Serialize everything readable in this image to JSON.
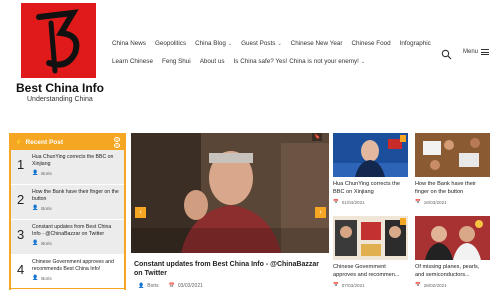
{
  "site": {
    "title": "Best China Info",
    "tagline": "Understanding China"
  },
  "nav": {
    "row1": [
      {
        "label": "China News",
        "has_dropdown": false
      },
      {
        "label": "Geopolitics",
        "has_dropdown": false
      },
      {
        "label": "China Blog",
        "has_dropdown": true
      },
      {
        "label": "Guest Posts",
        "has_dropdown": true
      },
      {
        "label": "Chinese New Year",
        "has_dropdown": false
      },
      {
        "label": "Chinese Food",
        "has_dropdown": false
      },
      {
        "label": "Infographic",
        "has_dropdown": false
      }
    ],
    "row2": [
      {
        "label": "Learn Chinese",
        "has_dropdown": false
      },
      {
        "label": "Feng Shui",
        "has_dropdown": false
      },
      {
        "label": "About us",
        "has_dropdown": false
      },
      {
        "label": "Is China safe? Yes! China is not your enemy!",
        "has_dropdown": true
      }
    ],
    "chevron": "⌄",
    "menu_label": "Menu"
  },
  "recent": {
    "heading": "Recent Post",
    "items": [
      {
        "num": "1",
        "title": "Hua ChunYing corrects the BBC on Xinjiang",
        "author": "Boris"
      },
      {
        "num": "2",
        "title": "How the Bank have their finger on the button",
        "author": "Boris"
      },
      {
        "num": "3",
        "title": "Constant updates from Best China Info - @ChinaBazzar on Twitter",
        "author": "Boris"
      },
      {
        "num": "4",
        "title": "Chinese Government approves and recommends Best China Info!",
        "author": "Boris"
      }
    ]
  },
  "feature": {
    "title": "Constant updates from Best China Info - @ChinaBazzar on Twitter",
    "author": "Boris",
    "date": "03/03/2021",
    "arrow_left": "‹",
    "arrow_right": "›"
  },
  "cards": [
    {
      "title": "Hua ChunYing corrects the BBC on Xinjiang",
      "date": "01/04/2021"
    },
    {
      "title": "How the Bank have their finger on the button",
      "date": "16/03/2021"
    },
    {
      "title": "Chinese Government approves and recommen...",
      "date": "07/03/2021"
    },
    {
      "title": "Of missing planes, pearls, and semiconductors...",
      "date": "28/02/2021"
    }
  ],
  "colors": {
    "accent": "#f5a623",
    "logo_red": "#e01a1a"
  }
}
